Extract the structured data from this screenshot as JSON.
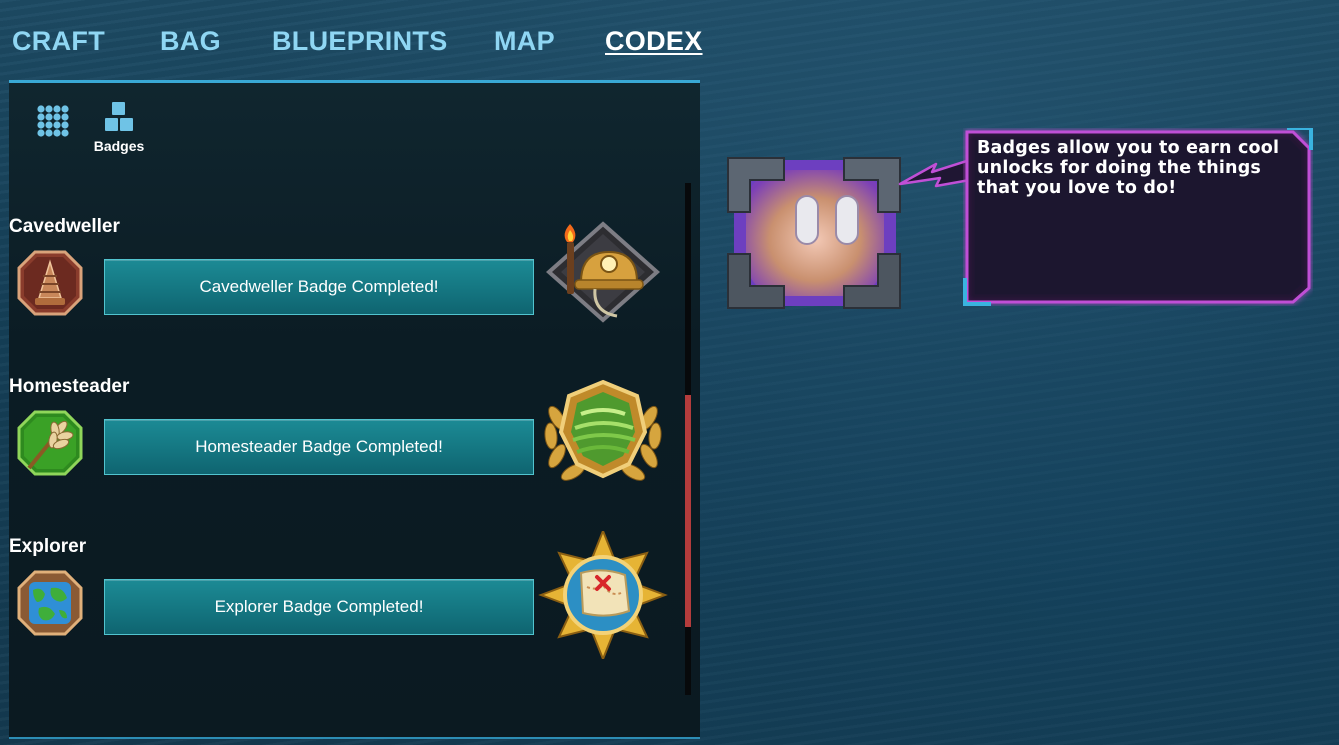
{
  "tabs": [
    {
      "label": "CRAFT",
      "active": false
    },
    {
      "label": "BAG",
      "active": false
    },
    {
      "label": "BLUEPRINTS",
      "active": false
    },
    {
      "label": "MAP",
      "active": false
    },
    {
      "label": "CODEX",
      "active": true
    }
  ],
  "filters": {
    "all_icon": "grid-icon",
    "badges_icon": "blocks-icon",
    "badges_label": "Badges"
  },
  "badges": [
    {
      "title": "Cavedweller",
      "button_label": "Cavedweller Badge Completed!",
      "icon": "drill-icon",
      "emblem": "miner-helmet-torch-emblem"
    },
    {
      "title": "Homesteader",
      "button_label": "Homesteader Badge Completed!",
      "icon": "wheat-icon",
      "emblem": "laurel-field-emblem"
    },
    {
      "title": "Explorer",
      "button_label": "Explorer Badge Completed!",
      "icon": "globe-cube-icon",
      "emblem": "treasure-map-compass-emblem"
    }
  ],
  "companion": {
    "message": "Badges allow you to earn cool unlocks for doing the things that you love to do!"
  },
  "colors": {
    "tab_text": "#8fd6f3",
    "active_tab_text": "#ffffff",
    "panel_accent": "#39a9d6",
    "button_fill": "#157883",
    "scroll_thumb": "#b53c3c",
    "bubble_border": "#c04fd6"
  }
}
